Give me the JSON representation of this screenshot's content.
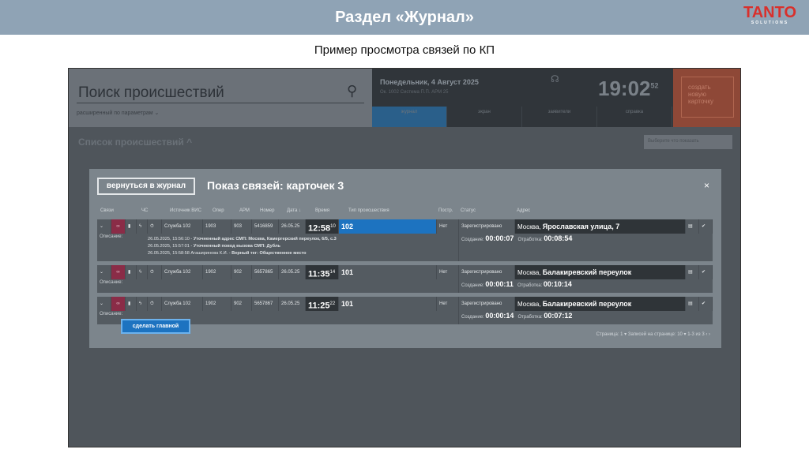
{
  "slide": {
    "title": "Раздел «Журнал»",
    "logo": "TANTO",
    "logo_sub": "SOLUTIONS",
    "subtitle": "Пример просмотра связей по КП"
  },
  "app": {
    "search_title": "Поиск происшествий",
    "search_sub": "расширенный по параметрам ⌄",
    "date": "Понедельник, 4 Август 2025",
    "info": "Ок. 1002 Система П.П.   APM 25",
    "clock": "19:02",
    "clock_sec": "52",
    "nav": [
      "журнал",
      "экран",
      "заявители",
      "справка"
    ],
    "create": "создать новую карточку",
    "list_title": "Список происшествий ^",
    "select": "Выберите что показать"
  },
  "modal": {
    "back": "вернуться в журнал",
    "title": "Показ связей: карточек 3",
    "close": "×",
    "columns": [
      "Связи",
      "ЧС",
      "Источник ВИС",
      "Опер",
      "АРМ",
      "Номер",
      "Дата ↓",
      "Время",
      "Тип происшествия",
      "Постр.",
      "Статус",
      "Адрес"
    ],
    "rows": [
      {
        "source": "Служба 102",
        "oper": "1903",
        "arm": "903",
        "number": "5416859",
        "date": "26.05.25",
        "time": "12:58",
        "sec": "10",
        "type": "102",
        "postr": "Нет",
        "status": "Зарегистрировано",
        "city": "Москва, ",
        "street": "Ярославская улица, 7",
        "desc_label": "Описание:",
        "created_label": "Создание:",
        "created": "00:00:07",
        "work_label": "Отработка:",
        "work": "00:08:54",
        "desc": [
          {
            "ts": "26.05.2025, 15:56:10 - ",
            "txt": "Уточненный адрес СМП: Москва, Камергерский переулок, 6/5, с.3"
          },
          {
            "ts": "26.05.2025, 15:57:01 - ",
            "txt": "Уточненный повод вызова СМП: Дубль"
          },
          {
            "ts": "26.05.2025, 15:58:58 Агаширинова К.И. - ",
            "txt": "Верный тег: Общественное место"
          }
        ]
      },
      {
        "source": "Служба 102",
        "oper": "1902",
        "arm": "902",
        "number": "5657865",
        "date": "26.05.25",
        "time": "11:35",
        "sec": "14",
        "type": "101",
        "postr": "Нет",
        "status": "Зарегистрировано",
        "city": "Москва, ",
        "street": "Балакиревский переулок",
        "desc_label": "Описание:",
        "created_label": "Создание:",
        "created": "00:00:11",
        "work_label": "Отработка:",
        "work": "00:10:14"
      },
      {
        "source": "Служба 102",
        "oper": "1902",
        "arm": "902",
        "number": "5657867",
        "date": "26.05.25",
        "time": "11:25",
        "sec": "22",
        "type": "101",
        "postr": "Нет",
        "status": "Зарегистрировано",
        "city": "Москва, ",
        "street": "Балакиревский переулок",
        "desc_label": "Описание:",
        "created_label": "Создание:",
        "created": "00:00:14",
        "work_label": "Отработка:",
        "work": "00:07:12"
      }
    ],
    "make_main": "сделать главной",
    "pager": "Страница: 1 ▾    Записей на странице: 10 ▾    1-3 из 3   ‹   ›"
  }
}
